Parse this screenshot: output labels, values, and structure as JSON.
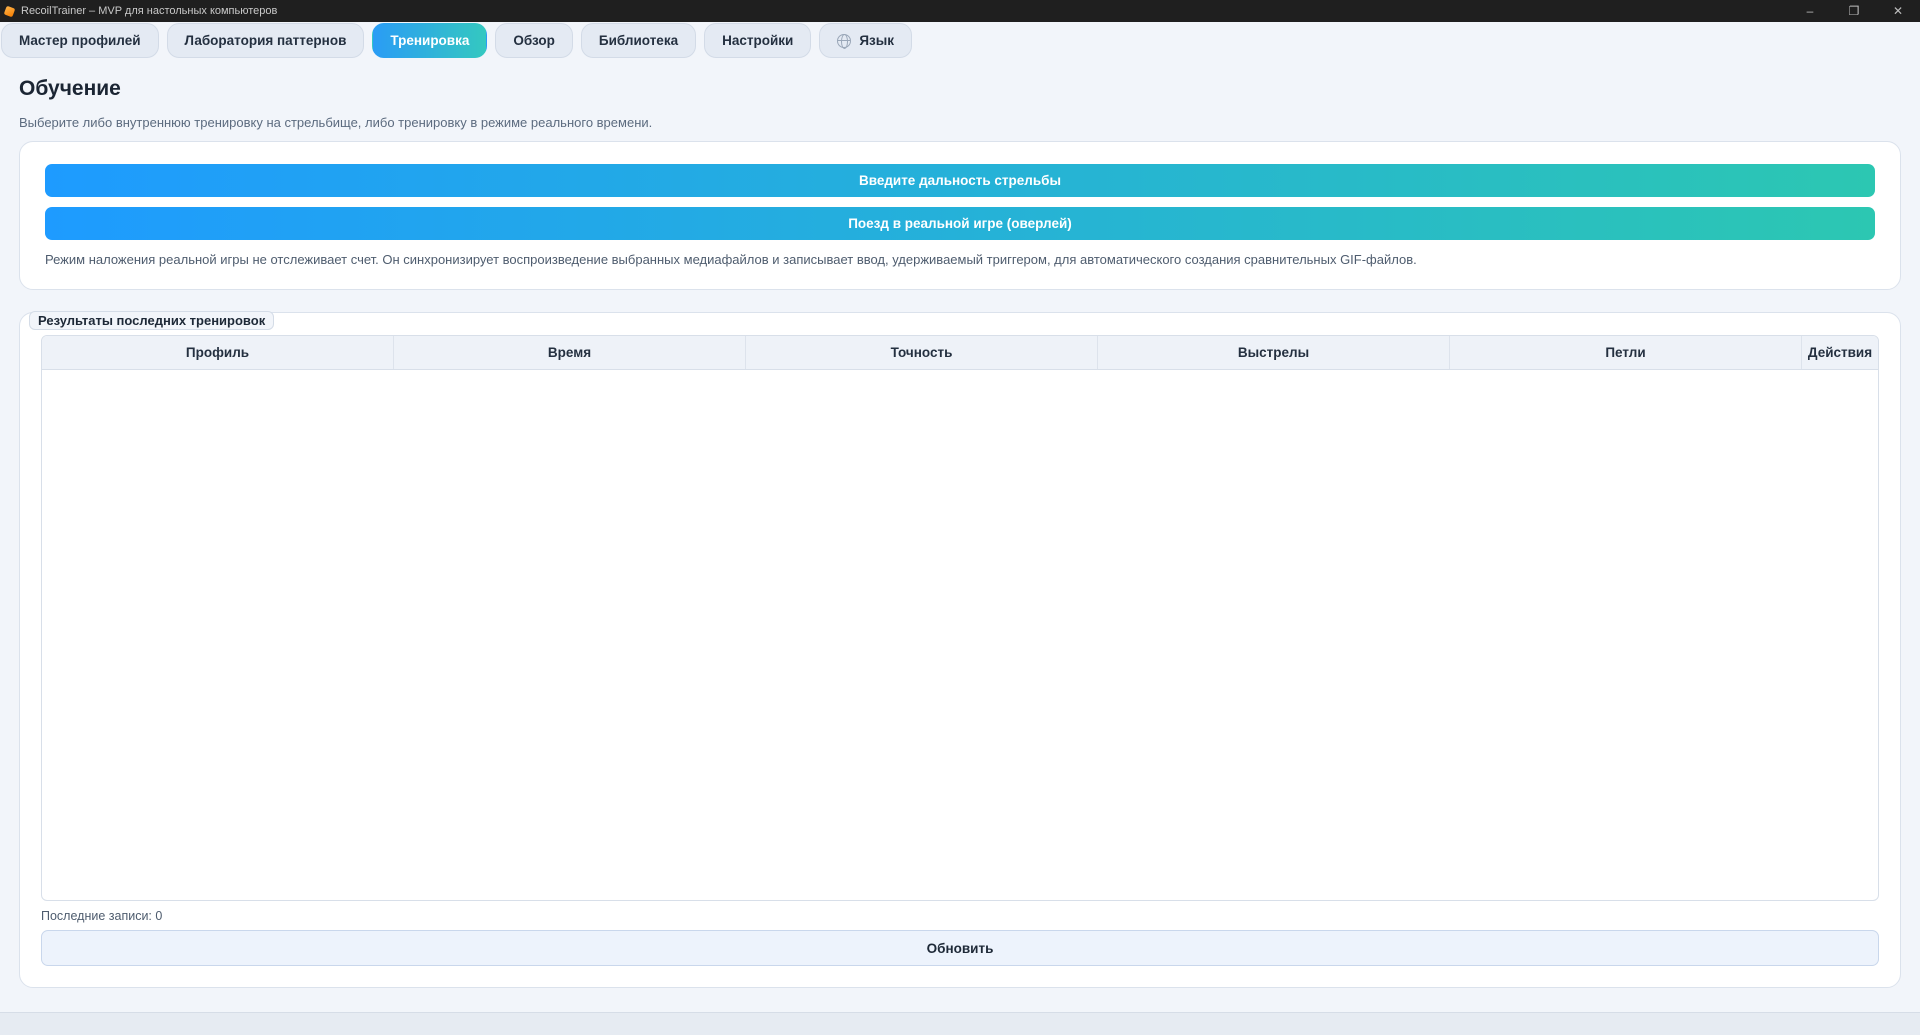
{
  "window": {
    "title": "RecoilTrainer – MVP для настольных компьютеров",
    "icon": "app-icon",
    "controls": [
      "minimize-icon",
      "restore-icon",
      "close-icon"
    ]
  },
  "tabs": [
    {
      "label": "Мастер профилей",
      "active": false
    },
    {
      "label": "Лаборатория паттернов",
      "active": false
    },
    {
      "label": "Тренировка",
      "active": true
    },
    {
      "label": "Обзор",
      "active": false
    },
    {
      "label": "Библиотека",
      "active": false
    },
    {
      "label": "Настройки",
      "active": false
    },
    {
      "label": "Язык",
      "active": false,
      "icon": "globe-icon"
    }
  ],
  "page": {
    "title": "Обучение",
    "subtitle": "Выберите либо внутреннюю тренировку на стрельбище, либо тренировку в режиме реального времени."
  },
  "training": {
    "range_button": "Введите дальность стрельбы",
    "overlay_button": "Поезд в реальной игре (оверлей)",
    "note": "Режим наложения реальной игры не отслеживает счет. Он синхронизирует воспроизведение выбранных медиафайлов и записывает ввод, удерживаемый триггером, для автоматического создания сравнительных GIF-файлов."
  },
  "results": {
    "legend": "Результаты последних тренировок",
    "columns": [
      "Профиль",
      "Время",
      "Точность",
      "Выстрелы",
      "Петли",
      "Действия"
    ],
    "rows": [],
    "footer": "Последние записи: 0",
    "refresh_button": "Обновить"
  },
  "colors": {
    "accent_start": "#1e9bff",
    "accent_end": "#2cc7b2",
    "background": "#f2f5fa"
  }
}
